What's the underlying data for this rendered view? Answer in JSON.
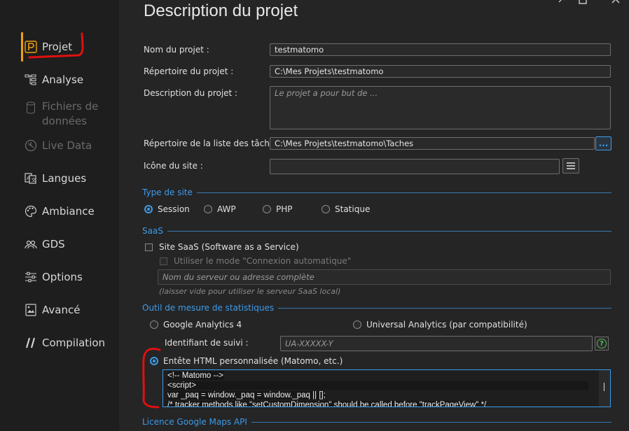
{
  "sidebar": {
    "items": [
      {
        "label": "Projet",
        "icon": "project-p-icon"
      },
      {
        "label": "Analyse",
        "icon": "analysis-tree-icon"
      },
      {
        "label": "Fichiers de données",
        "line1": "Fichiers de",
        "line2": "données",
        "icon": "database-icon"
      },
      {
        "label": "Live Data",
        "icon": "live-data-icon"
      },
      {
        "label": "Langues",
        "icon": "languages-icon"
      },
      {
        "label": "Ambiance",
        "icon": "palette-icon"
      },
      {
        "label": "GDS",
        "icon": "gds-users-icon"
      },
      {
        "label": "Options",
        "icon": "options-sliders-icon"
      },
      {
        "label": "Avancé",
        "icon": "advanced-image-icon"
      },
      {
        "label": "Compilation",
        "icon": "compilation-slashes-icon"
      }
    ]
  },
  "main": {
    "title": "Description du projet",
    "fields": {
      "name_label": "Nom du projet :",
      "name_value": "testmatomo",
      "dir_label": "Répertoire du projet :",
      "dir_value": "C:\\Mes Projets\\testmatomo",
      "desc_label": "Description du projet :",
      "desc_placeholder": "Le projet a pour but de ...",
      "tasks_label": "Répertoire de la liste des tâches :",
      "tasks_value": "C:\\Mes Projets\\testmatomo\\Taches",
      "tasks_browse": "...",
      "icon_label": "Icône du site :",
      "icon_value": ""
    },
    "site_type": {
      "title": "Type de site",
      "options": [
        "Session",
        "AWP",
        "PHP",
        "Statique"
      ],
      "selected": "Session"
    },
    "saas": {
      "title": "SaaS",
      "checkbox_label": "Site SaaS (Software as a Service)",
      "auto_label": "Utiliser le mode \"Connexion automatique\"",
      "server_placeholder": "Nom du serveur ou adresse complète",
      "hint": "(laisser vide pour utiliser le serveur SaaS local)"
    },
    "stats": {
      "title": "Outil de mesure de statistiques",
      "ga4_label": "Google Analytics 4",
      "ua_label": "Universal Analytics (par compatibilité)",
      "tracking_label": "Identifiant de suivi :",
      "tracking_placeholder": "UA-XXXXX-Y",
      "custom_label": "Entête HTML personnalisée (Matomo, etc.)",
      "selected": "Entête HTML personnalisée (Matomo, etc.)",
      "code_lines": [
        "<!-- Matomo -->",
        "<script>",
        " var _paq = window._paq = window._paq || [];",
        " /* tracker methods like \"setCustomDimension\" should be called before \"trackPageView\" */"
      ]
    },
    "maps": {
      "title": "Licence Google Maps API"
    }
  },
  "colors": {
    "accent": "#3d9be9",
    "active_bar": "#f0a010",
    "annotation_red": "#e01010",
    "help_green": "#5cb85c"
  }
}
